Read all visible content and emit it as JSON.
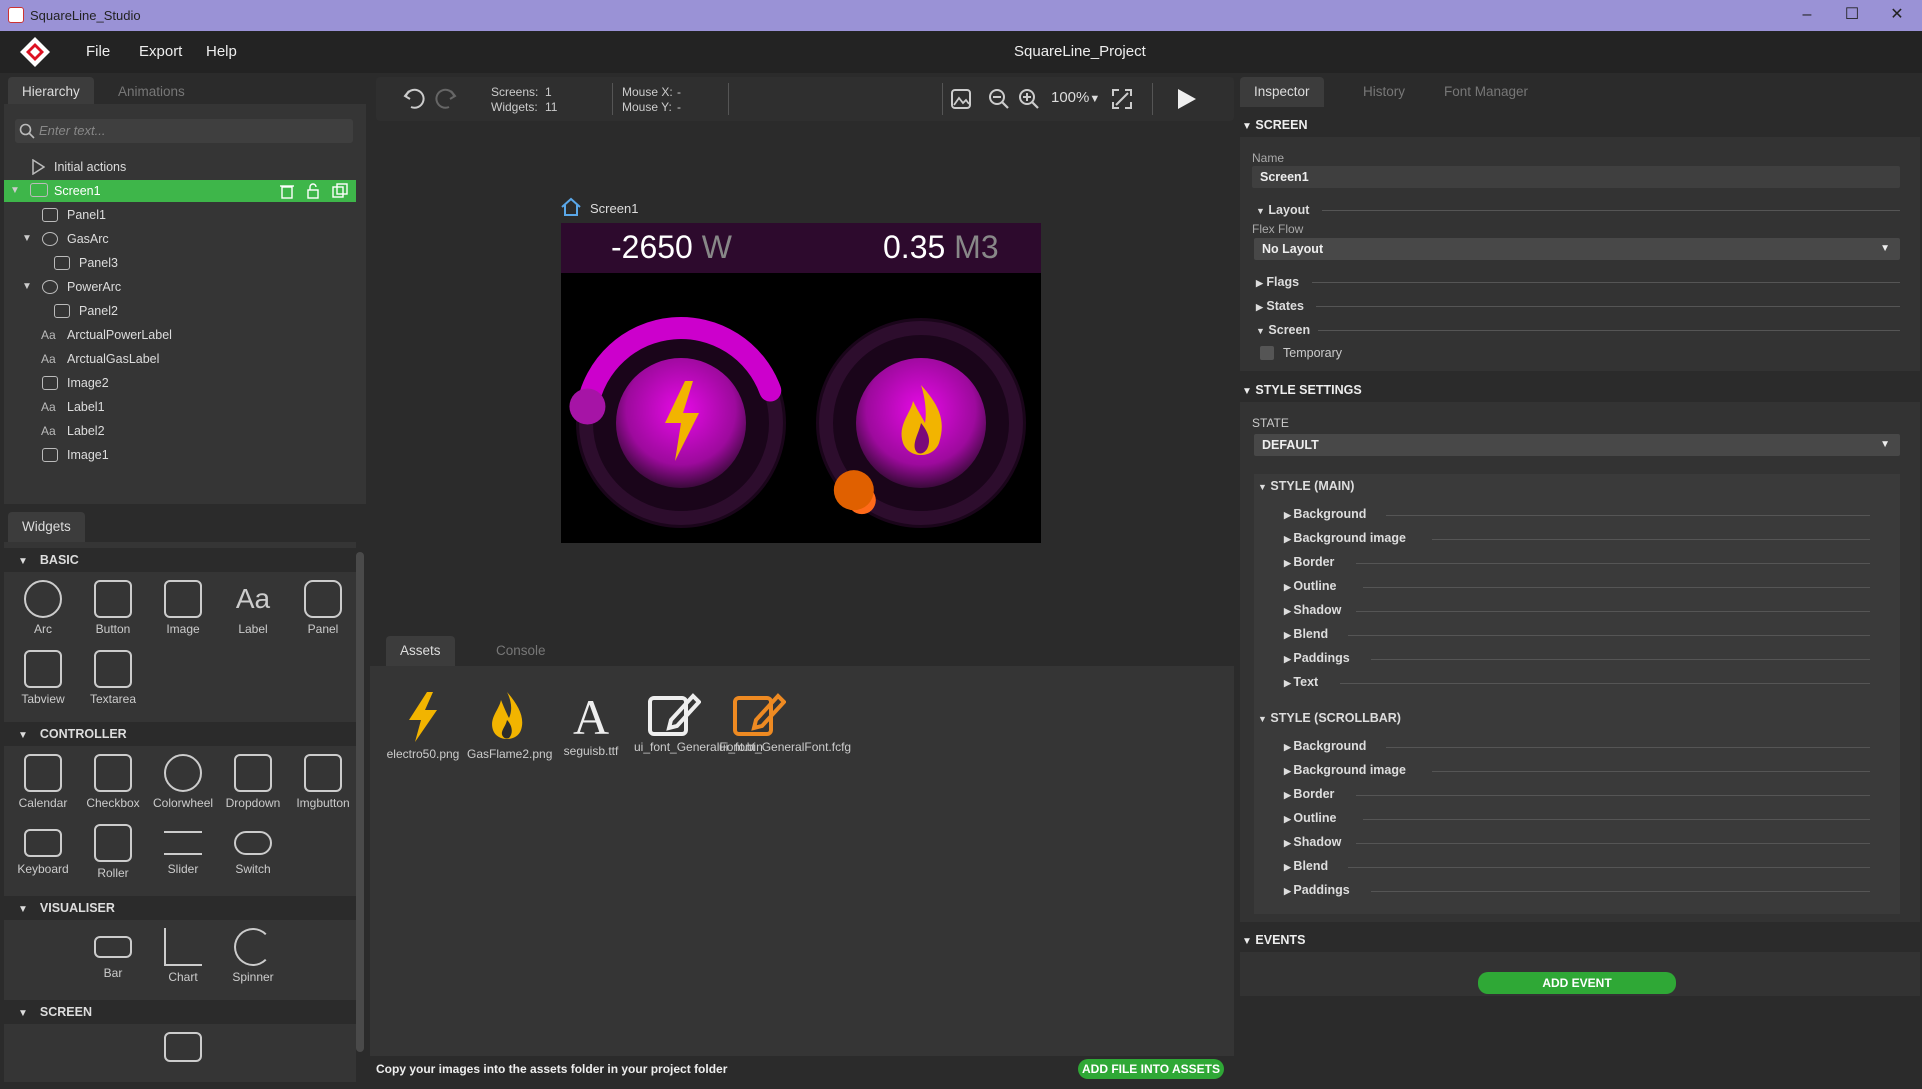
{
  "window": {
    "title": "SquareLine_Studio",
    "minimize": "–",
    "maximize": "☐",
    "close": "✕"
  },
  "menu": {
    "file": "File",
    "export": "Export",
    "help": "Help",
    "project": "SquareLine_Project"
  },
  "hierarchy": {
    "tabs": [
      "Hierarchy",
      "Animations"
    ],
    "search_placeholder": "Enter text...",
    "items": [
      {
        "label": "Initial actions",
        "icon": "play-icon"
      },
      {
        "label": "Screen1",
        "icon": "monitor-icon",
        "selected": true
      },
      {
        "label": "Panel1",
        "icon": "panel-icon"
      },
      {
        "label": "GasArc",
        "icon": "arc-icon"
      },
      {
        "label": "Panel3",
        "icon": "panel-icon"
      },
      {
        "label": "PowerArc",
        "icon": "arc-icon"
      },
      {
        "label": "Panel2",
        "icon": "panel-icon"
      },
      {
        "label": "ArctualPowerLabel",
        "icon": "label-icon"
      },
      {
        "label": "ArctualGasLabel",
        "icon": "label-icon"
      },
      {
        "label": "Image2",
        "icon": "image-icon"
      },
      {
        "label": "Label1",
        "icon": "label-icon"
      },
      {
        "label": "Label2",
        "icon": "label-icon"
      },
      {
        "label": "Image1",
        "icon": "image-icon"
      }
    ]
  },
  "widgets": {
    "tab": "Widgets",
    "sections": {
      "basic": {
        "title": "BASIC",
        "items": [
          "Arc",
          "Button",
          "Image",
          "Label",
          "Panel",
          "Tabview",
          "Textarea"
        ]
      },
      "controller": {
        "title": "CONTROLLER",
        "items": [
          "Calendar",
          "Checkbox",
          "Colorwheel",
          "Dropdown",
          "Imgbutton",
          "Keyboard",
          "Roller",
          "Slider",
          "Switch"
        ]
      },
      "visualiser": {
        "title": "VISUALISER",
        "items": [
          "Bar",
          "Chart",
          "Spinner"
        ]
      },
      "screen": {
        "title": "SCREEN"
      }
    }
  },
  "toolbar": {
    "screens_label": "Screens:",
    "screens_value": "1",
    "widgets_label": "Widgets:",
    "widgets_value": "11",
    "mousex_label": "Mouse X:",
    "mousex_value": "-",
    "mousey_label": "Mouse Y:",
    "mousey_value": "-",
    "zoom": "100%"
  },
  "canvas": {
    "screen_name": "Screen1",
    "power_value": "-2650",
    "power_unit": "W",
    "gas_value": "0.35",
    "gas_unit": "M3",
    "power_arc_level": 0.5,
    "gas_arc_level": 0.0,
    "accent": "#cc00cc",
    "gas_knob": "#e06000"
  },
  "assets": {
    "tabs": [
      "Assets",
      "Console"
    ],
    "files": [
      {
        "name": "electro50.png",
        "icon": "lightning-icon"
      },
      {
        "name": "GasFlame2.png",
        "icon": "flame-icon"
      },
      {
        "name": "seguisb.ttf",
        "icon": "font-icon"
      },
      {
        "name": "ui_font_GeneralFont.bin",
        "icon": "edit-icon"
      },
      {
        "name": "ui_font_GeneralFont.fcfg",
        "icon": "edit-icon"
      }
    ],
    "footer_text": "Copy your images into the assets folder in your project folder",
    "add_button": "ADD FILE INTO ASSETS"
  },
  "inspector": {
    "tabs": [
      "Inspector",
      "History",
      "Font Manager"
    ],
    "screen_section": "SCREEN",
    "name_label": "Name",
    "name_value": "Screen1",
    "layout": "Layout",
    "flex_flow_label": "Flex Flow",
    "flex_flow_value": "No Layout",
    "flags": "Flags",
    "states": "States",
    "screen_sub": "Screen",
    "temporary": "Temporary",
    "style_settings": "STYLE SETTINGS",
    "state_label": "STATE",
    "state_value": "DEFAULT",
    "style_main": "STYLE (MAIN)",
    "main_props": [
      "Background",
      "Background image",
      "Border",
      "Outline",
      "Shadow",
      "Blend",
      "Paddings",
      "Text"
    ],
    "style_scrollbar": "STYLE (SCROLLBAR)",
    "scroll_props": [
      "Background",
      "Background image",
      "Border",
      "Outline",
      "Shadow",
      "Blend",
      "Paddings"
    ],
    "events": "EVENTS",
    "add_event": "ADD EVENT"
  }
}
